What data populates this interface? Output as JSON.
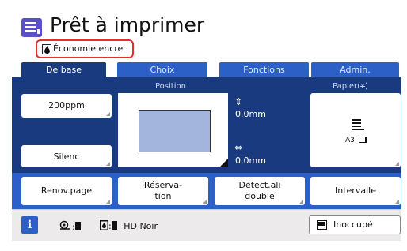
{
  "header": {
    "title": "Prêt à imprimer",
    "eco_label": "Économie encre",
    "title_icon": "document-list-icon",
    "eco_icon": "ink-drop-icon"
  },
  "tabs": [
    {
      "label": "De base",
      "active": true
    },
    {
      "label": "Choix",
      "active": false
    },
    {
      "label": "Fonctions",
      "active": false
    },
    {
      "label": "Admin.",
      "active": false
    }
  ],
  "main": {
    "speed_button": "200ppm",
    "quiet_button": "Silenc",
    "position_label": "Position",
    "vertical_offset": "0.0mm",
    "horizontal_offset": "0.0mm",
    "paper_label": "Papier(⚹)",
    "paper_size": "A3"
  },
  "actions": {
    "renov": "Renov.page",
    "reservation_line1": "Réserva-",
    "reservation_line2": "tion",
    "detect_line1": "Détect.ali",
    "detect_line2": "double",
    "interval": "Intervalle"
  },
  "status": {
    "info": "i",
    "color_mode": "HD Noir",
    "idle_label": "Inoccupé"
  },
  "colors": {
    "panel": "#1a3a80",
    "tab": "#2d60c7",
    "highlight": "#e0312a",
    "title_icon": "#5a4fc8"
  }
}
